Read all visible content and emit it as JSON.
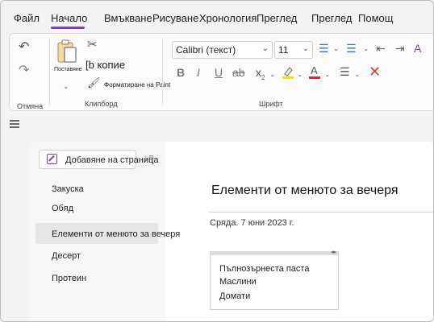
{
  "menu": {
    "tabs": [
      "Файл",
      "Начало",
      "Вмъкване",
      "Рисуване",
      "Хронология",
      "Преглед",
      "Преглед",
      "Помощ"
    ]
  },
  "ribbon": {
    "undo_group_label": "Отмяна",
    "paste_label": "Поставяне",
    "copy_label": "[b копие",
    "format_painter_label": "Форматиране на Paint",
    "clipboard_group_label": "Клипборд",
    "font_name": "Calibri (текст)",
    "font_size": "11",
    "font_group_label": "Шрифт",
    "accent_color": "#7b3fbf",
    "highlight_color": "#f5e400",
    "font_color": "#e0242a",
    "clear_color": "#d93c3c"
  },
  "pages": {
    "add_page_label": "Добавяне на страница",
    "items": [
      "Закуска",
      "Обяд",
      "Елементи от менюто за вечеря",
      "Десерт",
      "Протеин"
    ],
    "selected_index": 2
  },
  "page": {
    "title": "Елементи от менюто за вечеря",
    "date": "Сряда. 7 юни 2023 г.",
    "note_lines": [
      "Пълнозърнеста паста",
      "Маслини",
      "Домати"
    ]
  }
}
